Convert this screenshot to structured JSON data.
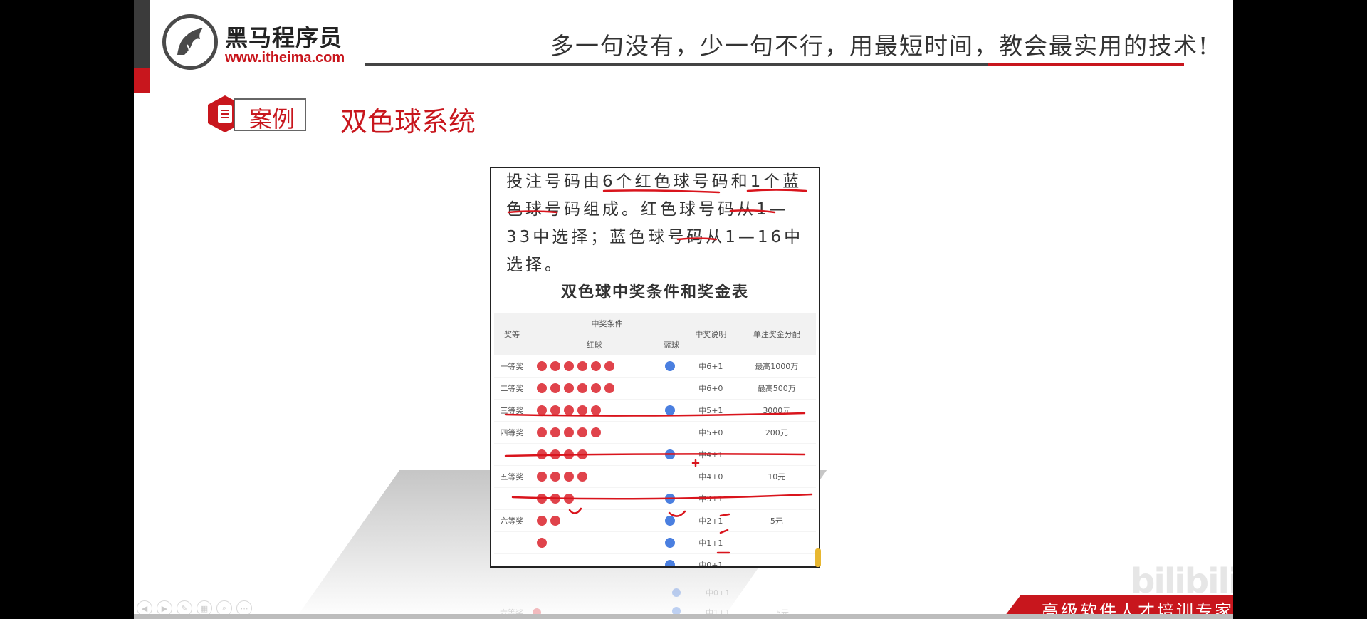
{
  "header": {
    "logo_cn": "黑马程序员",
    "logo_url": "www.itheima.com",
    "slogan": "多一句没有，少一句不行，用最短时间，教会最实用的技术!"
  },
  "section": {
    "badge_label": "案例",
    "title": "双色球系统"
  },
  "rules_text": "投注号码由6个红色球号码和1个蓝色球号码组成。红色球号码从1—33中选择；蓝色球号码从1—16中选择。",
  "prize_table": {
    "title": "双色球中奖条件和奖金表",
    "headers": {
      "level": "奖等",
      "condition": "中奖条件",
      "red": "红球",
      "blue": "蓝球",
      "desc": "中奖说明",
      "amount": "单注奖金分配"
    },
    "rows": [
      {
        "level": "一等奖",
        "red": 6,
        "blue": 1,
        "desc": "中6+1",
        "amount": "最高1000万"
      },
      {
        "level": "二等奖",
        "red": 6,
        "blue": 0,
        "desc": "中6+0",
        "amount": "最高500万"
      },
      {
        "level": "三等奖",
        "red": 5,
        "blue": 1,
        "desc": "中5+1",
        "amount": "3000元"
      },
      {
        "level": "四等奖",
        "red": 5,
        "blue": 0,
        "desc": "中5+0",
        "amount": "200元"
      },
      {
        "level": "",
        "red": 4,
        "blue": 1,
        "desc": "中4+1",
        "amount": ""
      },
      {
        "level": "五等奖",
        "red": 4,
        "blue": 0,
        "desc": "中4+0",
        "amount": "10元"
      },
      {
        "level": "",
        "red": 3,
        "blue": 1,
        "desc": "中3+1",
        "amount": ""
      },
      {
        "level": "六等奖",
        "red": 2,
        "blue": 1,
        "desc": "中2+1",
        "amount": "5元"
      },
      {
        "level": "",
        "red": 1,
        "blue": 1,
        "desc": "中1+1",
        "amount": ""
      },
      {
        "level": "",
        "red": 0,
        "blue": 1,
        "desc": "中0+1",
        "amount": ""
      }
    ],
    "colors": {
      "red_ball": "#e0434b",
      "blue_ball": "#4a7fe0"
    }
  },
  "ghost_reflection": {
    "desc_1": "中0+1",
    "desc_2": "中1+1",
    "level": "六等奖",
    "amount": "5元"
  },
  "footer": {
    "tagline": "高级软件人才培训专家",
    "watermark": "bilibili"
  },
  "toolbar_icons": [
    "prev-icon",
    "play-icon",
    "pen-icon",
    "slides-icon",
    "zoom-icon",
    "more-icon"
  ],
  "accent_color": "#c8161d"
}
